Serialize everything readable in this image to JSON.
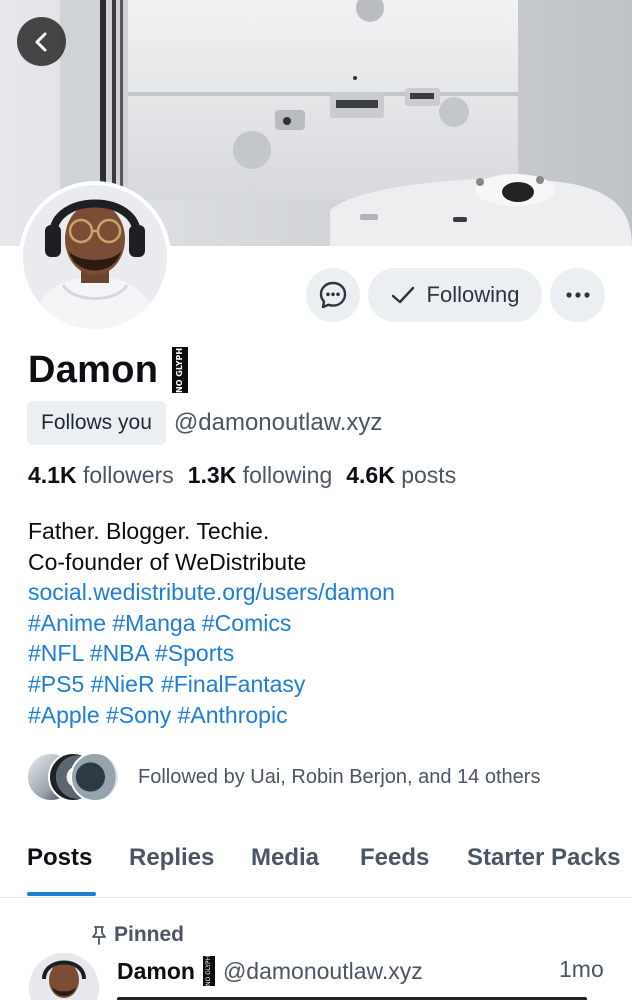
{
  "profile": {
    "display_name": "Damon",
    "missing_glyph": "NO GLYPH",
    "follows_you": "Follows you",
    "handle": "@damonoutlaw.xyz"
  },
  "actions": {
    "following_label": "Following"
  },
  "stats": {
    "followers_count": "4.1K",
    "followers_label": "followers",
    "following_count": "1.3K",
    "following_label": "following",
    "posts_count": "4.6K",
    "posts_label": "posts"
  },
  "bio": {
    "line1": "Father. Blogger. Techie.",
    "line2": "Co-founder of WeDistribute",
    "link": "social.wedistribute.org/users/damon",
    "tags": [
      "#Anime #Manga #Comics",
      "#NFL #NBA #Sports",
      "#PS5 #NieR #FinalFantasy",
      "#Apple #Sony #Anthropic"
    ]
  },
  "followed_by": {
    "text": "Followed by Uai, Robin Berjon, and 14 others"
  },
  "tabs": [
    {
      "label": "Posts",
      "active": true
    },
    {
      "label": "Replies"
    },
    {
      "label": "Media"
    },
    {
      "label": "Feeds"
    },
    {
      "label": "Starter Packs"
    }
  ],
  "post": {
    "pinned_label": "Pinned",
    "author_name": "Damon",
    "author_handle": "@damonoutlaw.xyz",
    "time": "1mo"
  },
  "icons": {
    "back": "arrow-left-icon",
    "chat": "chat-bubble-icon",
    "check": "check-icon",
    "more": "ellipsis-icon",
    "pin": "pin-icon"
  },
  "colors": {
    "accent": "#1d7ed6",
    "button_bg": "#eceff2",
    "muted_text": "#4b5563"
  }
}
